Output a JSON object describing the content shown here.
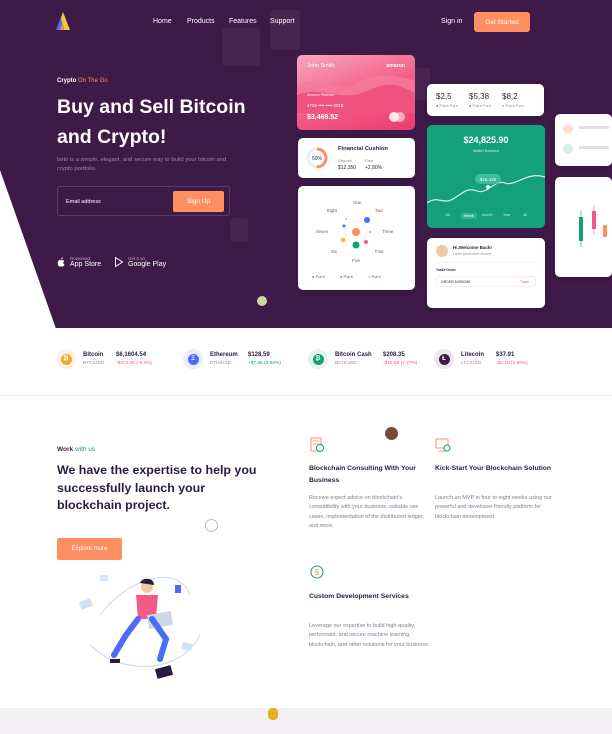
{
  "nav": {
    "links": [
      "Home",
      "Products",
      "Features",
      "Support"
    ],
    "signin": "Sign in",
    "cta": "Get Started"
  },
  "hero": {
    "eyebrow_a": "Crypto",
    "eyebrow_b": "On The Go",
    "title_line1": "Buy and Sell Bitcoin",
    "title_line2": "and Crypto!",
    "desc": "beto is a simple, elegant, and secure way to build your bitcoin and crypto portfolio.",
    "email_placeholder": "Email address",
    "signup": "Sign Up",
    "appstore_small": "Download",
    "appstore_big": "App Store",
    "gplay_small": "Get it on",
    "gplay_big": "Google Play"
  },
  "widgets": {
    "card": {
      "name": "John Smith",
      "brand": "amazon",
      "label": "Amazon Platinum",
      "number": "4756  ••••  ••••  9018",
      "amount": "$3.469.52"
    },
    "cushion": {
      "title": "Financial Cushion",
      "percent": "50%",
      "deposit_label": "Deposit",
      "deposit": "$12,350",
      "rate_label": "Rate",
      "rate": "+2,80%"
    },
    "radial": {
      "labels": [
        "One",
        "Two",
        "Three",
        "Four",
        "Five",
        "Six",
        "Seven",
        "Eight"
      ],
      "legend": [
        "Point",
        "Point",
        "Point"
      ]
    },
    "prices": [
      {
        "value": "$2,5",
        "label": "Point Four",
        "color": "#4a6cf7"
      },
      {
        "value": "$5,38",
        "label": "Point Four",
        "color": "#14a07a"
      },
      {
        "value": "$8,2",
        "label": "Point Four",
        "color": "#ff8e63"
      }
    ],
    "balance": {
      "amount": "$24,825.90",
      "label": "Wallet Balance",
      "tag": "$16,425",
      "tabs": [
        "1M",
        "Week",
        "Month",
        "Year",
        "All"
      ],
      "active_tab": "Week"
    },
    "welcome": {
      "title": "Hi,Welcome Back!",
      "subtitle": "Lorem ipsum dolor sit amet",
      "section": "Trade Order",
      "order": "ORDER-54354256",
      "status": "Trade"
    }
  },
  "ticker": [
    {
      "name": "Bitcoin",
      "pair": "BTC/USD",
      "price": "$6,1604.54",
      "change": "-$474.40 (-6.3%)",
      "positive": false,
      "color": "#f7a531",
      "bg": "#fff3e0",
      "symbol": "₿"
    },
    {
      "name": "Ethereum",
      "pair": "ETH/USD",
      "price": "$128.59",
      "change": "+$7.56 (5.92%)",
      "positive": true,
      "color": "#4a6cf7",
      "bg": "#e9edff",
      "symbol": "Ξ"
    },
    {
      "name": "Bitcoin Cash",
      "pair": "BCH/USD",
      "price": "$208.35",
      "change": "-$16.68 (7.27%)",
      "positive": false,
      "color": "#14a07a",
      "bg": "#e2f5ef",
      "symbol": "₿"
    },
    {
      "name": "Litecoin",
      "pair": "LTC/USD",
      "price": "$37.91",
      "change": "-$2.10 (5.60%)",
      "positive": false,
      "color": "#3d1a48",
      "bg": "#ece8ee",
      "symbol": "Ł"
    }
  ],
  "work": {
    "eyebrow_a": "Work",
    "eyebrow_b": "with us",
    "title": "We have the expertise to help you successfully launch your blockchain project.",
    "explore": "Explore more"
  },
  "features": [
    {
      "title": "Blockchain Consulting With Your Business",
      "desc": "Receive expert advice on blockchain's compatibility with your business, suitable use cases, implementation of the distributed ledger, and more."
    },
    {
      "title": "Kick-Start Your Blockchain Solution",
      "desc": "Launch an MVP in four to eight weeks using our powerful and developer-friendly platform for blockchain development."
    },
    {
      "title": "Custom Development Services",
      "desc": "Leverage our expertise to build high-quality, performant, and secure machine learning, blockchain, and other solutions for your business."
    }
  ],
  "colors": {
    "hero_bg": "#3d1a48",
    "accent": "#ff8e63",
    "green": "#14a07a",
    "blue": "#4a6cf7"
  }
}
